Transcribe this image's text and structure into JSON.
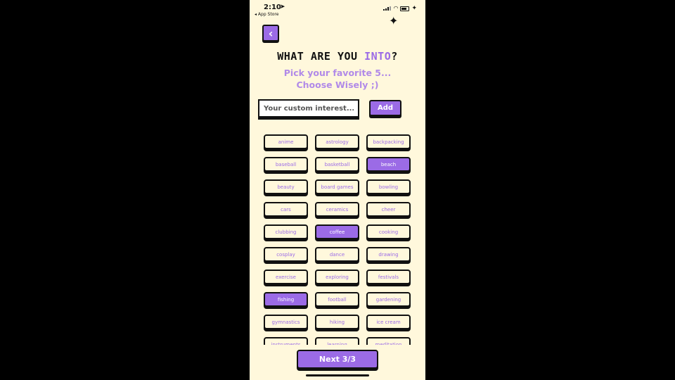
{
  "status_bar": {
    "time": "2:10",
    "back_app": "◂ App Store"
  },
  "header": {
    "title_prefix": "WHAT ARE YOU ",
    "title_accent": "INTO",
    "title_suffix": "?",
    "subtitle_line1": "Pick your favorite 5...",
    "subtitle_line2": "Choose Wisely ;)"
  },
  "custom": {
    "placeholder": "Your custom interest...",
    "value": "",
    "add_label": "Add"
  },
  "interests": [
    {
      "label": "anime",
      "selected": false
    },
    {
      "label": "astrology",
      "selected": false
    },
    {
      "label": "backpacking",
      "selected": false
    },
    {
      "label": "baseball",
      "selected": false
    },
    {
      "label": "basketball",
      "selected": false
    },
    {
      "label": "beach",
      "selected": true
    },
    {
      "label": "beauty",
      "selected": false
    },
    {
      "label": "board games",
      "selected": false
    },
    {
      "label": "bowling",
      "selected": false
    },
    {
      "label": "cars",
      "selected": false
    },
    {
      "label": "ceramics",
      "selected": false
    },
    {
      "label": "cheer",
      "selected": false
    },
    {
      "label": "clubbing",
      "selected": false
    },
    {
      "label": "coffee",
      "selected": true
    },
    {
      "label": "cooking",
      "selected": false
    },
    {
      "label": "cosplay",
      "selected": false
    },
    {
      "label": "dance",
      "selected": false
    },
    {
      "label": "drawing",
      "selected": false
    },
    {
      "label": "exercise",
      "selected": false
    },
    {
      "label": "exploring",
      "selected": false
    },
    {
      "label": "festivals",
      "selected": false
    },
    {
      "label": "fishing",
      "selected": true
    },
    {
      "label": "football",
      "selected": false
    },
    {
      "label": "gardening",
      "selected": false
    },
    {
      "label": "gymnastics",
      "selected": false
    },
    {
      "label": "hiking",
      "selected": false
    },
    {
      "label": "ice cream",
      "selected": false
    },
    {
      "label": "instruments",
      "selected": false
    },
    {
      "label": "learning",
      "selected": false
    },
    {
      "label": "meditation",
      "selected": false
    }
  ],
  "footer": {
    "next_label": "Next 3/3"
  },
  "colors": {
    "accent": "#9b6be6",
    "background": "#fff8dc",
    "subtitle": "#b18ae8"
  }
}
